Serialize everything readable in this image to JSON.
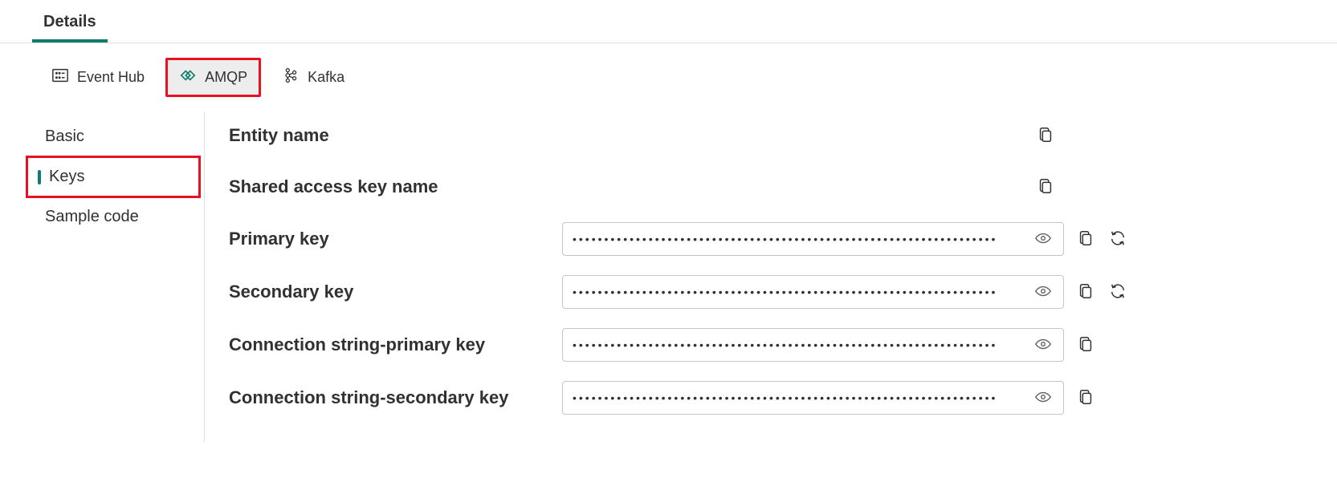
{
  "topTabs": {
    "details": "Details"
  },
  "subTabs": {
    "eventHub": "Event Hub",
    "amqp": "AMQP",
    "kafka": "Kafka"
  },
  "sidebar": {
    "basic": "Basic",
    "keys": "Keys",
    "sampleCode": "Sample code"
  },
  "fields": {
    "entityName": {
      "label": "Entity name"
    },
    "sharedAccessKeyName": {
      "label": "Shared access key name"
    },
    "primaryKey": {
      "label": "Primary key",
      "masked": "•••••••••••••••••••••••••••••••••••••••••••••••••••••••••••••••••••"
    },
    "secondaryKey": {
      "label": "Secondary key",
      "masked": "•••••••••••••••••••••••••••••••••••••••••••••••••••••••••••••••••••"
    },
    "connPrimary": {
      "label": "Connection string-primary key",
      "masked": "•••••••••••••••••••••••••••••••••••••••••••••••••••••••••••••••••••"
    },
    "connSecondary": {
      "label": "Connection string-secondary key",
      "masked": "•••••••••••••••••••••••••••••••••••••••••••••••••••••••••••••••••••"
    }
  }
}
